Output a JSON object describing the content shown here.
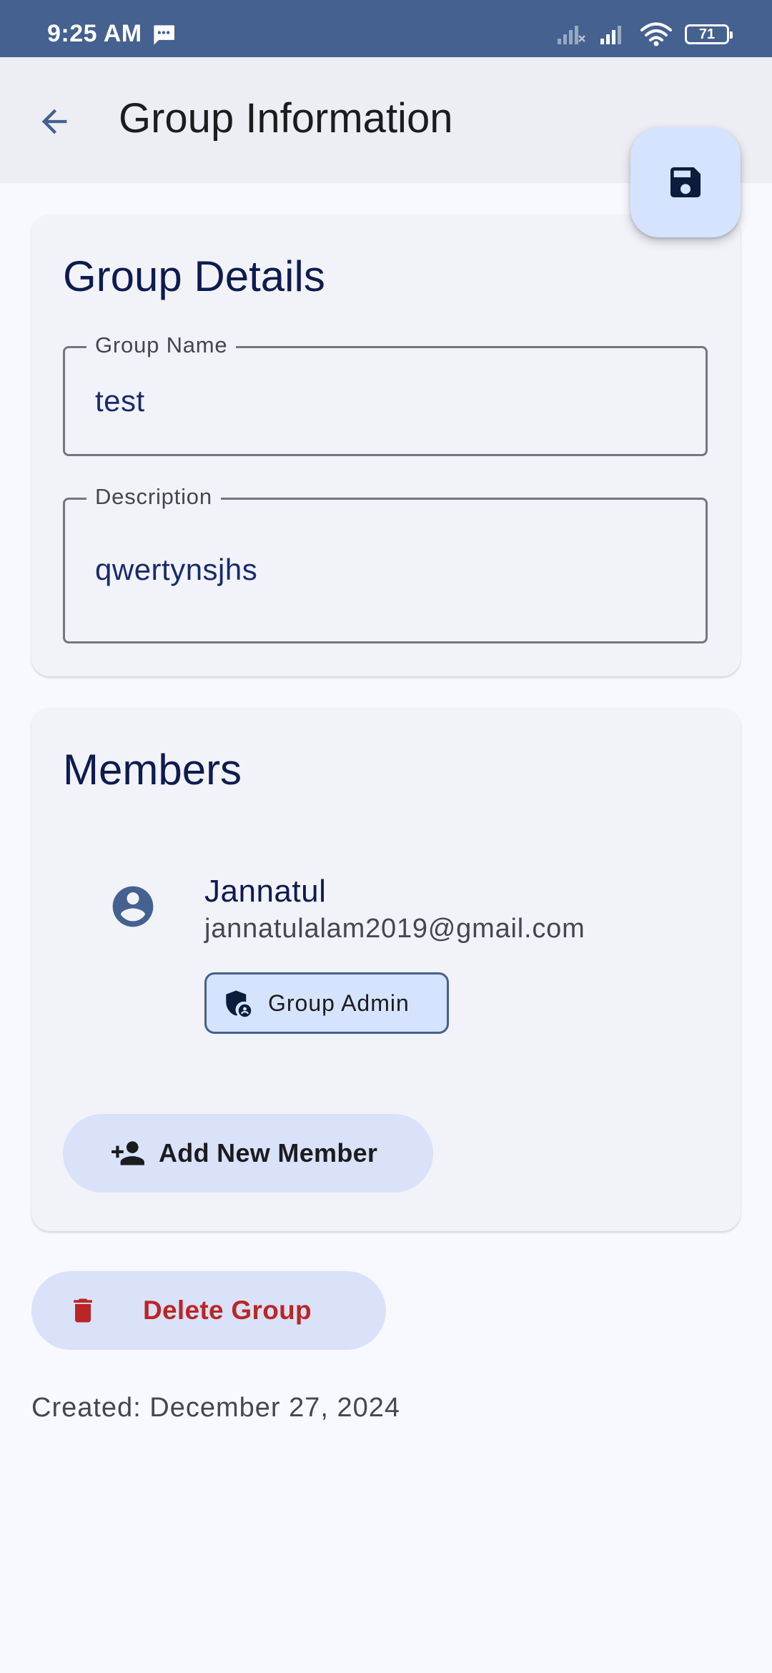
{
  "status_bar": {
    "time": "9:25 AM",
    "battery": "71",
    "icons": [
      "message-icon",
      "signal-icon",
      "signal-icon",
      "wifi-icon",
      "battery-icon"
    ]
  },
  "app_bar": {
    "title": "Group Information",
    "back_icon": "arrow-back-icon",
    "save_icon": "save-icon"
  },
  "details": {
    "title": "Group Details",
    "group_name": {
      "label": "Group Name",
      "value": "test"
    },
    "description": {
      "label": "Description",
      "value": "qwertynsjhs"
    }
  },
  "members": {
    "title": "Members",
    "items": [
      {
        "name": "Jannatul",
        "email": "jannatulalam2019@gmail.com",
        "role": "Group Admin",
        "avatar_icon": "account-circle-icon",
        "role_icon": "admin-shield-icon"
      }
    ],
    "add_button": {
      "label": "Add New Member",
      "icon": "person-add-icon"
    }
  },
  "delete_button": {
    "label": "Delete Group",
    "icon": "trash-icon"
  },
  "created": "Created: December 27, 2024",
  "colors": {
    "status_bar": "#44618f",
    "app_bar": "#eceef4",
    "background": "#f8f9ff",
    "card": "#f1f3f9",
    "fab": "#d6e3ff",
    "tonal_button": "#dae2f9",
    "delete_text": "#ba2626",
    "primary": "#44618f"
  }
}
